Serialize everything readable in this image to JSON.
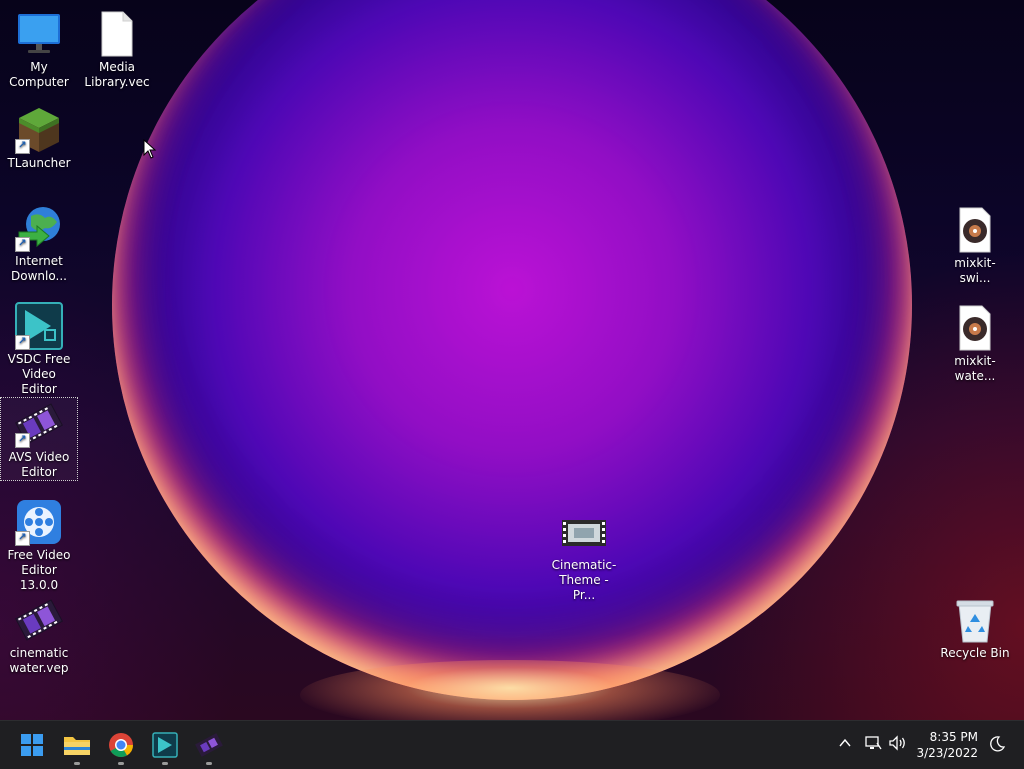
{
  "desktop": {
    "icons": [
      {
        "label": "My Computer",
        "icon": "monitor-icon"
      },
      {
        "label": "Media Library.vec",
        "icon": "document-icon"
      },
      {
        "label": "TLauncher",
        "icon": "grass-block-icon"
      },
      {
        "label": "Internet Downlo...",
        "icon": "globe-download-icon"
      },
      {
        "label": "VSDC Free Video Editor",
        "icon": "vsdc-icon"
      },
      {
        "label": "AVS Video Editor",
        "icon": "film-reel-icon"
      },
      {
        "label": "Free Video Editor 13.0.0",
        "icon": "film-wheel-icon"
      },
      {
        "label": "cinematic water.vep",
        "icon": "film-reel-icon"
      },
      {
        "label": "mixkit-swi...",
        "icon": "audio-file-icon"
      },
      {
        "label": "mixkit-wate...",
        "icon": "audio-file-icon"
      },
      {
        "label": "Cinematic-Theme - Pr...",
        "icon": "video-file-icon"
      },
      {
        "label": "Recycle Bin",
        "icon": "recycle-bin-icon"
      }
    ]
  },
  "taskbar": {
    "apps": [
      {
        "name": "Start",
        "icon": "windows-icon"
      },
      {
        "name": "File Explorer",
        "icon": "folder-icon"
      },
      {
        "name": "Google Chrome",
        "icon": "chrome-icon"
      },
      {
        "name": "VSDC Free Video Editor",
        "icon": "vsdc-icon"
      },
      {
        "name": "AVS Video Editor",
        "icon": "film-reel-icon"
      }
    ],
    "tray": {
      "chevron": "chevron-up-icon",
      "network": "network-icon",
      "volume": "speaker-icon",
      "time": "8:35 PM",
      "date": "3/23/2022",
      "focus": "focus-moon-icon"
    }
  },
  "colors": {
    "taskbar": "#1f1f22",
    "accent": "#3b8ee6"
  }
}
